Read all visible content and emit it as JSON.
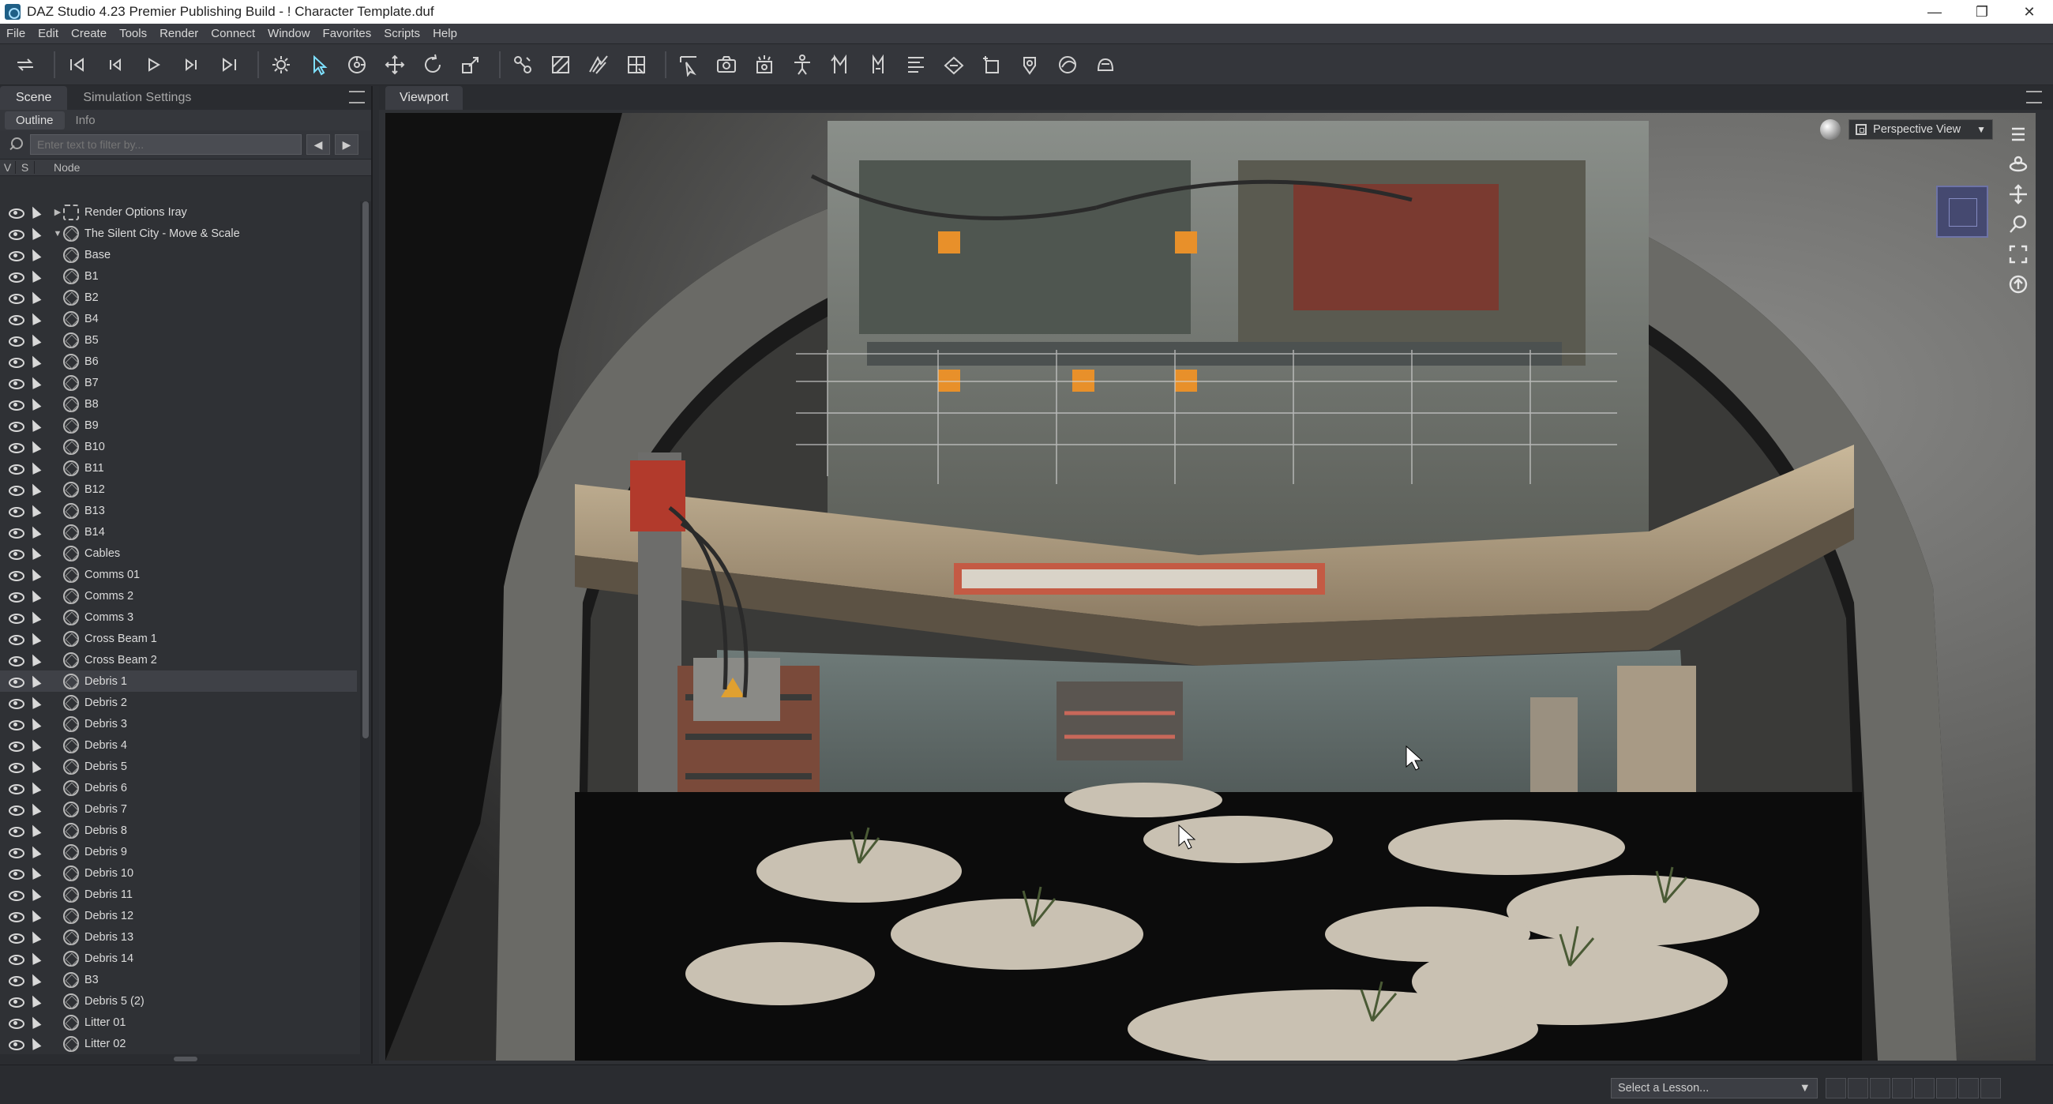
{
  "window": {
    "title": "DAZ Studio 4.23 Premier Publishing Build - ! Character Template.duf",
    "minimize": "—",
    "maximize": "❐",
    "close": "✕"
  },
  "menu": [
    "File",
    "Edit",
    "Create",
    "Tools",
    "Render",
    "Connect",
    "Window",
    "Favorites",
    "Scripts",
    "Help"
  ],
  "left_panel": {
    "tabs": [
      "Scene",
      "Simulation Settings"
    ],
    "sub_tabs": [
      "Outline",
      "Info"
    ],
    "filter_placeholder": "Enter text to filter by...",
    "prev_label": "◀",
    "next_label": "▶",
    "columns": {
      "v": "V",
      "s": "S",
      "node": "Node"
    },
    "nodes": [
      {
        "label": "Render Options Iray",
        "level": 0,
        "expander": "▶",
        "type": "render"
      },
      {
        "label": "The Silent City - Move & Scale",
        "level": 0,
        "expander": "▼",
        "type": "group"
      },
      {
        "label": "Base",
        "level": 1,
        "expander": "",
        "type": "prop"
      },
      {
        "label": "B1",
        "level": 1,
        "expander": "",
        "type": "prop"
      },
      {
        "label": "B2",
        "level": 1,
        "expander": "",
        "type": "prop"
      },
      {
        "label": "B4",
        "level": 1,
        "expander": "",
        "type": "prop"
      },
      {
        "label": "B5",
        "level": 1,
        "expander": "",
        "type": "prop"
      },
      {
        "label": "B6",
        "level": 1,
        "expander": "",
        "type": "prop"
      },
      {
        "label": "B7",
        "level": 1,
        "expander": "",
        "type": "prop"
      },
      {
        "label": "B8",
        "level": 1,
        "expander": "",
        "type": "prop"
      },
      {
        "label": "B9",
        "level": 1,
        "expander": "",
        "type": "prop"
      },
      {
        "label": "B10",
        "level": 1,
        "expander": "",
        "type": "prop"
      },
      {
        "label": "B11",
        "level": 1,
        "expander": "",
        "type": "prop"
      },
      {
        "label": "B12",
        "level": 1,
        "expander": "",
        "type": "prop"
      },
      {
        "label": "B13",
        "level": 1,
        "expander": "",
        "type": "prop"
      },
      {
        "label": "B14",
        "level": 1,
        "expander": "",
        "type": "prop"
      },
      {
        "label": "Cables",
        "level": 1,
        "expander": "",
        "type": "prop"
      },
      {
        "label": "Comms 01",
        "level": 1,
        "expander": "",
        "type": "prop"
      },
      {
        "label": "Comms 2",
        "level": 1,
        "expander": "",
        "type": "prop"
      },
      {
        "label": "Comms 3",
        "level": 1,
        "expander": "",
        "type": "prop"
      },
      {
        "label": "Cross Beam 1",
        "level": 1,
        "expander": "",
        "type": "prop"
      },
      {
        "label": "Cross Beam 2",
        "level": 1,
        "expander": "",
        "type": "prop"
      },
      {
        "label": "Debris 1",
        "level": 1,
        "expander": "",
        "type": "prop",
        "selected": true
      },
      {
        "label": "Debris 2",
        "level": 1,
        "expander": "",
        "type": "prop"
      },
      {
        "label": "Debris 3",
        "level": 1,
        "expander": "",
        "type": "prop"
      },
      {
        "label": "Debris 4",
        "level": 1,
        "expander": "",
        "type": "prop"
      },
      {
        "label": "Debris 5",
        "level": 1,
        "expander": "",
        "type": "prop"
      },
      {
        "label": "Debris 6",
        "level": 1,
        "expander": "",
        "type": "prop"
      },
      {
        "label": "Debris 7",
        "level": 1,
        "expander": "",
        "type": "prop"
      },
      {
        "label": "Debris 8",
        "level": 1,
        "expander": "",
        "type": "prop"
      },
      {
        "label": "Debris 9",
        "level": 1,
        "expander": "",
        "type": "prop"
      },
      {
        "label": "Debris 10",
        "level": 1,
        "expander": "",
        "type": "prop"
      },
      {
        "label": "Debris 11",
        "level": 1,
        "expander": "",
        "type": "prop"
      },
      {
        "label": "Debris 12",
        "level": 1,
        "expander": "",
        "type": "prop"
      },
      {
        "label": "Debris 13",
        "level": 1,
        "expander": "",
        "type": "prop"
      },
      {
        "label": "Debris 14",
        "level": 1,
        "expander": "",
        "type": "prop"
      },
      {
        "label": "B3",
        "level": 1,
        "expander": "",
        "type": "prop"
      },
      {
        "label": "Debris 5 (2)",
        "level": 1,
        "expander": "",
        "type": "prop"
      },
      {
        "label": "Litter 01",
        "level": 1,
        "expander": "",
        "type": "prop"
      },
      {
        "label": "Litter 02",
        "level": 1,
        "expander": "",
        "type": "prop"
      }
    ]
  },
  "viewport": {
    "tab": "Viewport",
    "camera": "Perspective View",
    "camera_arrow": "▼"
  },
  "toolbar_icons": [
    "undo-redo-icon",
    "first-frame-icon",
    "prev-frame-icon",
    "play-icon",
    "next-frame-icon",
    "last-frame-icon",
    "render-settings-icon",
    "node-selection-icon",
    "universal-tool-icon",
    "translate-icon",
    "rotate-icon",
    "scale-icon",
    "joint-editor-icon",
    "surface-selection-icon",
    "geometry-editor-icon",
    "region-nav-icon",
    "active-pose-icon",
    "camera-icon",
    "light-icon",
    "figure-icon",
    "morph-icon",
    "dform-icon",
    "align-icon",
    "bake-icon",
    "create-prop-icon",
    "spot-render-icon",
    "render-icon",
    "iray-icon"
  ],
  "status": {
    "lesson_placeholder": "Select a Lesson...",
    "lesson_arrow": "▼"
  }
}
